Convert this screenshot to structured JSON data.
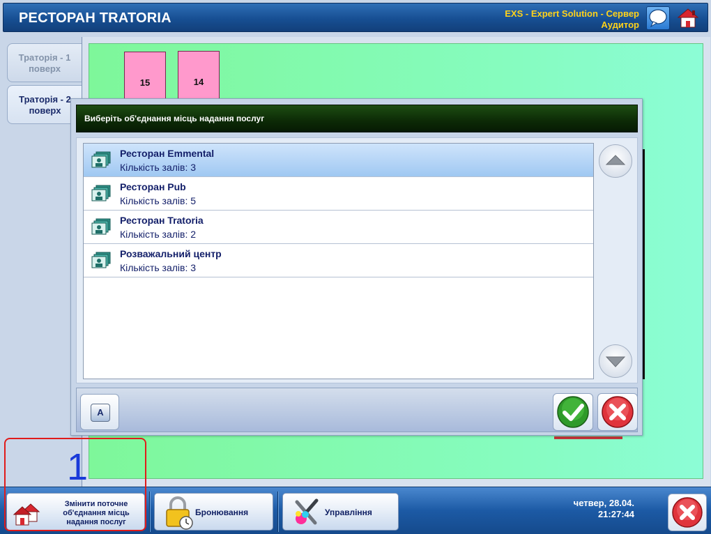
{
  "header": {
    "title": "РЕСТОРАН TRATORIA",
    "server": "EXS - Expert Solution - Сервер",
    "user": "Аудитор"
  },
  "floor_tabs": [
    {
      "label": "Траторія - 1 поверх",
      "state": "inactive"
    },
    {
      "label": "Траторія - 2 поверх",
      "state": "active"
    }
  ],
  "tables": [
    {
      "number": "15"
    },
    {
      "number": "14"
    }
  ],
  "dialog": {
    "title": "Виберіть об'єднання місць надання послуг",
    "items": [
      {
        "name": "Ресторан Emmental",
        "halls": "Кількість залів: 3",
        "selected": true
      },
      {
        "name": "Ресторан Pub",
        "halls": "Кількість залів: 5",
        "selected": false
      },
      {
        "name": "Ресторан Tratoria",
        "halls": "Кількість залів: 2",
        "selected": false
      },
      {
        "name": "Розважальний центр",
        "halls": "Кількість залів: 3",
        "selected": false
      }
    ],
    "keyboard_label": "A"
  },
  "annotation": {
    "number": "1"
  },
  "toolbar": {
    "change_venue_label": "Змінити поточне об'єднання місць надання послуг",
    "booking_label": "Бронювання",
    "management_label": "Управління",
    "date": "четвер, 28.04.",
    "time": "21:27:44"
  },
  "colors": {
    "header_bg": "#174f93",
    "header_text_accent": "#ffd21a",
    "plan_bg": "#7ef79a",
    "table_tile": "#ff99cc",
    "dialog_title_bg": "#0c2a06",
    "selected_row": "#9fc8f2",
    "annotation": "#e01b1b"
  }
}
